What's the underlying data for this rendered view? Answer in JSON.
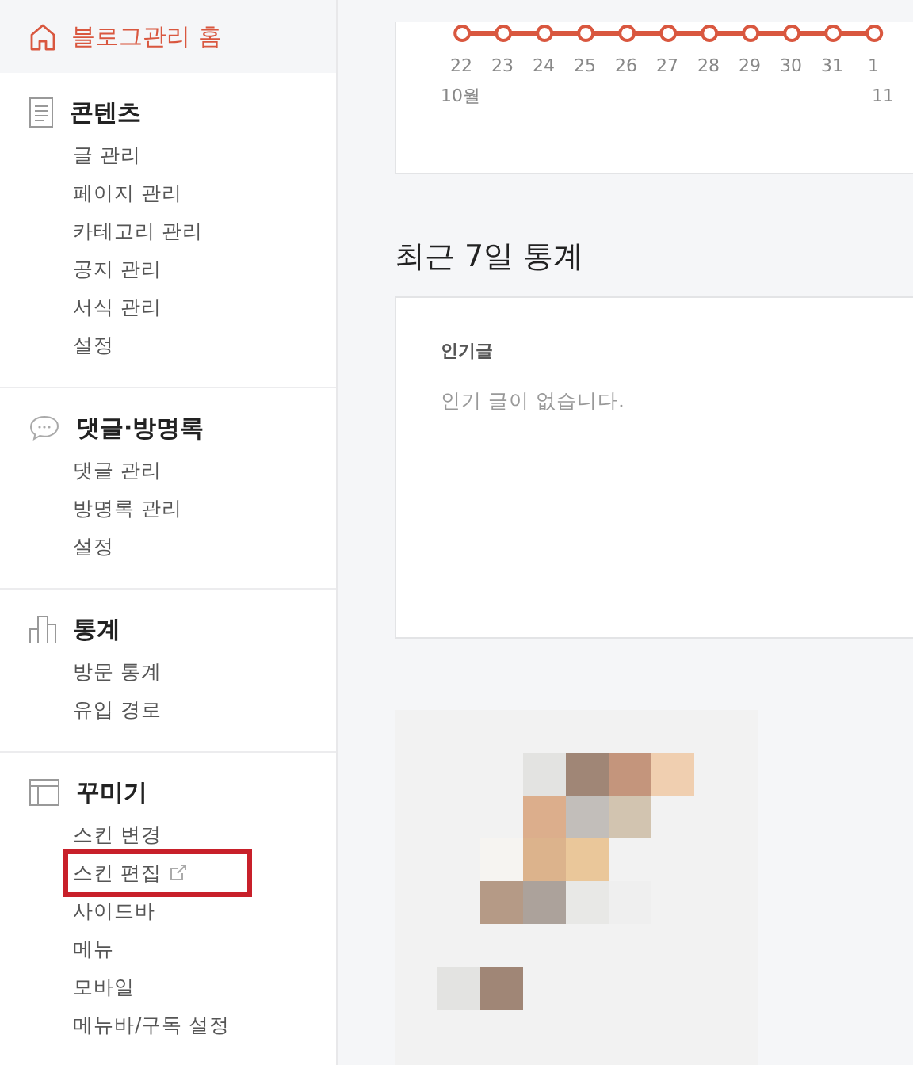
{
  "home": {
    "label": "블로그관리 홈"
  },
  "sections": [
    {
      "title": "콘텐츠",
      "items": [
        {
          "label": "글 관리",
          "external": false,
          "highlighted": false
        },
        {
          "label": "페이지 관리",
          "external": false,
          "highlighted": false
        },
        {
          "label": "카테고리 관리",
          "external": false,
          "highlighted": false
        },
        {
          "label": "공지 관리",
          "external": false,
          "highlighted": false
        },
        {
          "label": "서식 관리",
          "external": false,
          "highlighted": false
        },
        {
          "label": "설정",
          "external": false,
          "highlighted": false
        }
      ]
    },
    {
      "title": "댓글·방명록",
      "items": [
        {
          "label": "댓글 관리",
          "external": false,
          "highlighted": false
        },
        {
          "label": "방명록 관리",
          "external": false,
          "highlighted": false
        },
        {
          "label": "설정",
          "external": false,
          "highlighted": false
        }
      ]
    },
    {
      "title": "통계",
      "items": [
        {
          "label": "방문 통계",
          "external": false,
          "highlighted": false
        },
        {
          "label": "유입 경로",
          "external": false,
          "highlighted": false
        }
      ]
    },
    {
      "title": "꾸미기",
      "items": [
        {
          "label": "스킨 변경",
          "external": false,
          "highlighted": false
        },
        {
          "label": "스킨 편집",
          "external": true,
          "highlighted": true
        },
        {
          "label": "사이드바",
          "external": false,
          "highlighted": false
        },
        {
          "label": "메뉴",
          "external": false,
          "highlighted": false
        },
        {
          "label": "모바일",
          "external": false,
          "highlighted": false
        },
        {
          "label": "메뉴바/구독 설정",
          "external": false,
          "highlighted": false
        }
      ]
    }
  ],
  "visit_chart": {
    "days": [
      "22",
      "23",
      "24",
      "25",
      "26",
      "27",
      "28",
      "29",
      "30",
      "31",
      "1"
    ],
    "months": [
      {
        "label": "10월"
      },
      {
        "label": "11"
      }
    ]
  },
  "recent_stats": {
    "title": "최근 7일 통계",
    "popular_label": "인기글",
    "empty_message": "인기 글이 없습니다."
  }
}
